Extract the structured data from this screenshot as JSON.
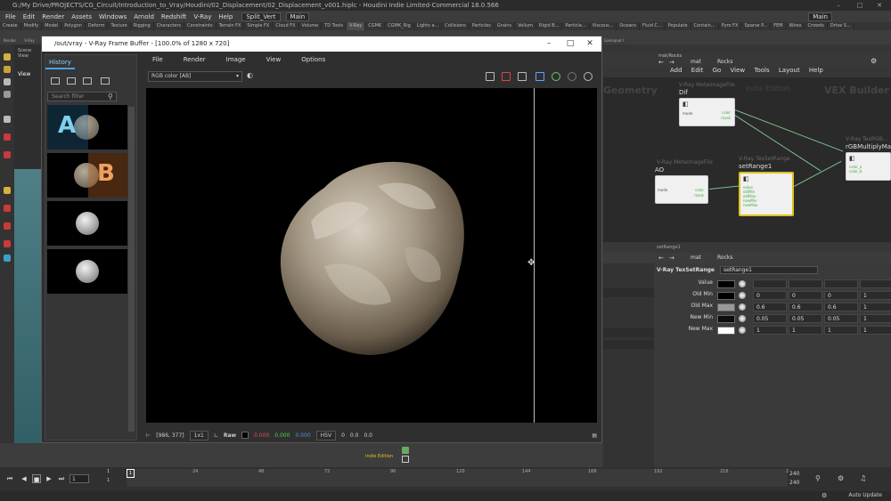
{
  "window": {
    "title": "G:/My Drive/PROJECTS/CG_Circuit/Introduction_to_Vray/Houdini/02_Displacement/02_Displacement_v001.hiplc - Houdini Indie Limited-Commercial 18.0.566"
  },
  "menubar": {
    "items": [
      "File",
      "Edit",
      "Render",
      "Assets",
      "Windows",
      "Arnold",
      "Redshift",
      "V-Ray",
      "Help"
    ],
    "layout": "Split_Vert",
    "desktop": "Main",
    "right_desktop": "Main"
  },
  "shelf_tabs": [
    "Create",
    "Modify",
    "Model",
    "Polygon",
    "Deform",
    "Texture",
    "Rigging",
    "Characters",
    "Constraints",
    "Terrain FX",
    "Simple FX",
    "Cloud FX",
    "Volume",
    "TD Tools",
    "V-Ray",
    "CGMK",
    "CGMK_Rig",
    "Lights a...",
    "Collisions",
    "Particles",
    "Grains",
    "Vellum",
    "Rigid B...",
    "Particle...",
    "Viscous...",
    "Oceans",
    "Fluid C...",
    "Populate",
    "Contain...",
    "Pyro FX",
    "Sparse P...",
    "FEM",
    "Wires",
    "Crowds",
    "Drive S..."
  ],
  "shelf_icons": [
    "Render",
    "V-Ray",
    "Light",
    "Env",
    "Cam",
    "VRScene",
    "Proxy",
    "Mat",
    "Fur",
    "Volume",
    "Environment Light",
    "Sky Light",
    "GI Light",
    "Caustic Light",
    "Portal Light",
    "Ambient Light",
    "Stereo Camera",
    "VR Camera",
    "Switcher",
    "Gamepad Camera"
  ],
  "scene_view": {
    "tab": "Scene View",
    "view_label": "View"
  },
  "vfb": {
    "title": "/out/vray - V-Ray Frame Buffer - [100.0% of 1280 x 720]",
    "menu": [
      "File",
      "Render",
      "Image",
      "View",
      "Options"
    ],
    "channel": "RGB color [AB]",
    "history_tab": "History",
    "search_placeholder": "Search filter",
    "thumbs": [
      {
        "letter": "A"
      },
      {
        "letter": "B"
      },
      {
        "letter": ""
      },
      {
        "letter": ""
      }
    ],
    "status": {
      "coords": "[986, 377]",
      "zoom": "1x1",
      "raw_label": "Raw",
      "r": "0.000",
      "g": "0.000",
      "b": "0.000",
      "mode": "HSV",
      "h": "0",
      "s": "0.0",
      "v": "0.0"
    },
    "badge": "Indie Edition"
  },
  "network": {
    "path_tab": "mat",
    "path_node": "Rocks",
    "path_tab2": "mat/Rocks",
    "menu": [
      "Add",
      "Edit",
      "Go",
      "View",
      "Tools",
      "Layout",
      "Help"
    ],
    "labels": {
      "geometry": "Geometry",
      "indie": "Indie Edition",
      "vex": "VEX Builder"
    },
    "nodes": [
      {
        "type": "V-Ray MetaImageFile",
        "name": "Dif"
      },
      {
        "type": "V-Ray MetaImageFile",
        "name": "AO"
      },
      {
        "type": "V-Ray TexSetRange",
        "name": "setRange1"
      },
      {
        "type": "V-Ray TexRGB...",
        "name": "rGBMultiplyMa..."
      }
    ],
    "ports": {
      "dif_in": "mode",
      "dif_out1": "color",
      "dif_out2": "mask",
      "sr_in": [
        "value",
        "oldMin",
        "oldMax",
        "newMin",
        "newMax"
      ],
      "rgb_in": [
        "color_a",
        "color_b"
      ],
      "ao_in": "mode",
      "ao_out1": "color",
      "ao_out2": "mask"
    }
  },
  "params": {
    "tab": "setRange1",
    "path_node": "Rocks",
    "path_tab": "mat",
    "node_type": "V-Ray TexSetRange",
    "node_name": "setRange1",
    "rows": [
      {
        "label": "Value",
        "swatch": "#000000",
        "vals": [
          "",
          "",
          "",
          ""
        ]
      },
      {
        "label": "Old Min",
        "swatch": "#000000",
        "vals": [
          "0",
          "0",
          "0",
          "1"
        ]
      },
      {
        "label": "Old Max",
        "swatch": "#999999",
        "vals": [
          "0.6",
          "0.6",
          "0.6",
          "1"
        ]
      },
      {
        "label": "New Min",
        "swatch": "#0d0d0d",
        "vals": [
          "0.05",
          "0.05",
          "0.05",
          "1"
        ]
      },
      {
        "label": "New Max",
        "swatch": "#ffffff",
        "vals": [
          "1",
          "1",
          "1",
          "1"
        ]
      }
    ]
  },
  "timeline": {
    "frame": "1",
    "start": "1",
    "start2": "1",
    "end": "240",
    "end2": "240",
    "ticks": [
      "24",
      "48",
      "72",
      "96",
      "120",
      "144",
      "168",
      "192",
      "216",
      "2"
    ]
  },
  "statusbar": {
    "auto_update": "Auto Update"
  }
}
